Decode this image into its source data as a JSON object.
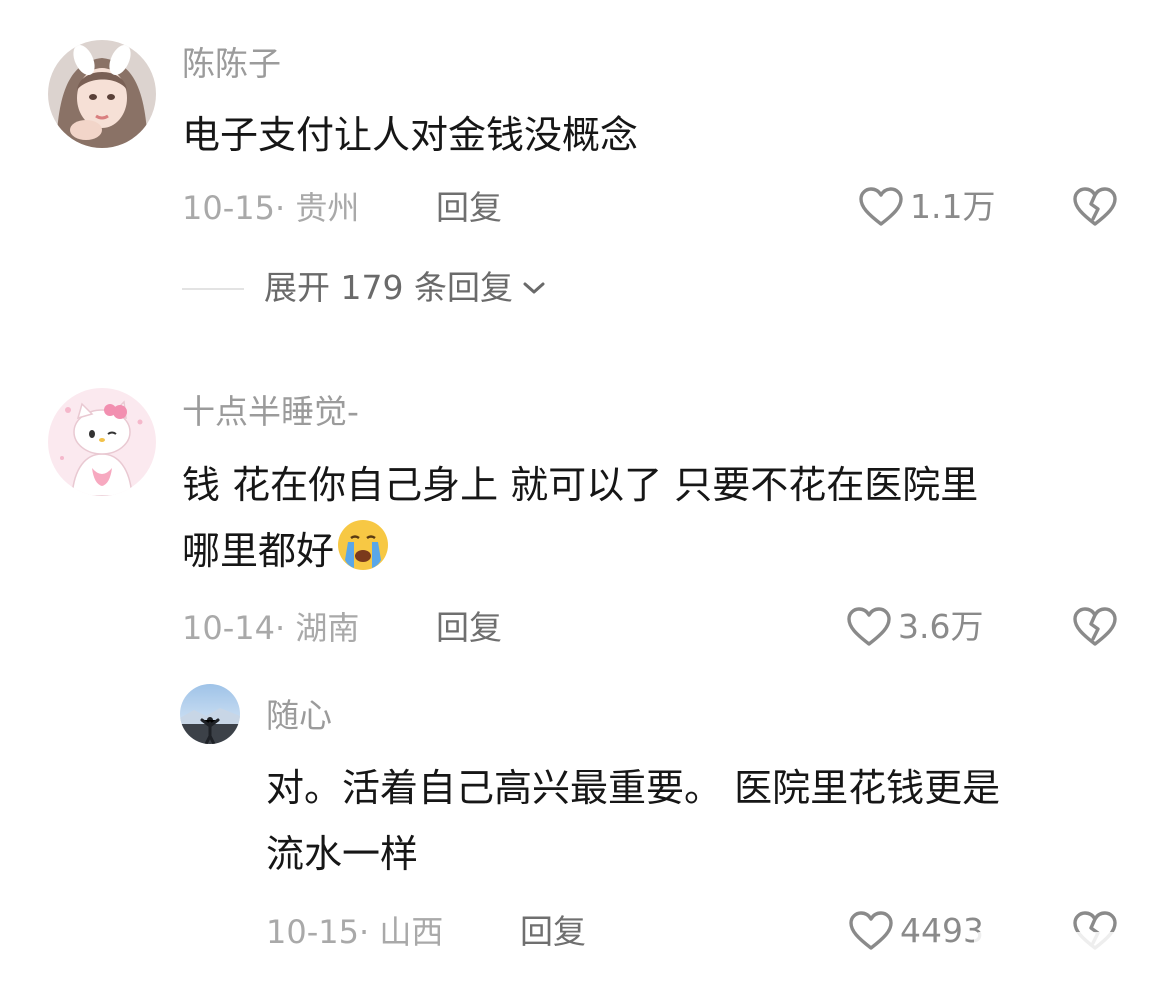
{
  "comments": [
    {
      "username": "陈陈子",
      "content_lines": [
        "电子支付让人对金钱没概念"
      ],
      "meta": "10-15· 贵州",
      "reply_label": "回复",
      "likes": "1.1万"
    },
    {
      "username": "十点半睡觉-",
      "content_lines": [
        "钱 花在你自己身上 就可以了 只要不花在医院里",
        "哪里都好"
      ],
      "meta": "10-14· 湖南",
      "reply_label": "回复",
      "likes": "3.6万"
    }
  ],
  "expand_replies": {
    "label": "展开 179 条回复"
  },
  "sub_reply": {
    "username": "随心",
    "content_lines": [
      "对。活着自己高兴最重要。 医院里花钱更是",
      "流水一样"
    ],
    "meta": "10-15· 山西",
    "reply_label": "回复",
    "likes": "4493"
  },
  "colors": {
    "text_primary": "#161616",
    "text_secondary": "#9b9b9b",
    "icon": "#8a8a8a"
  },
  "icons": [
    "heart-outline-icon",
    "broken-heart-icon",
    "chevron-down-icon",
    "crying-face-emoji"
  ]
}
